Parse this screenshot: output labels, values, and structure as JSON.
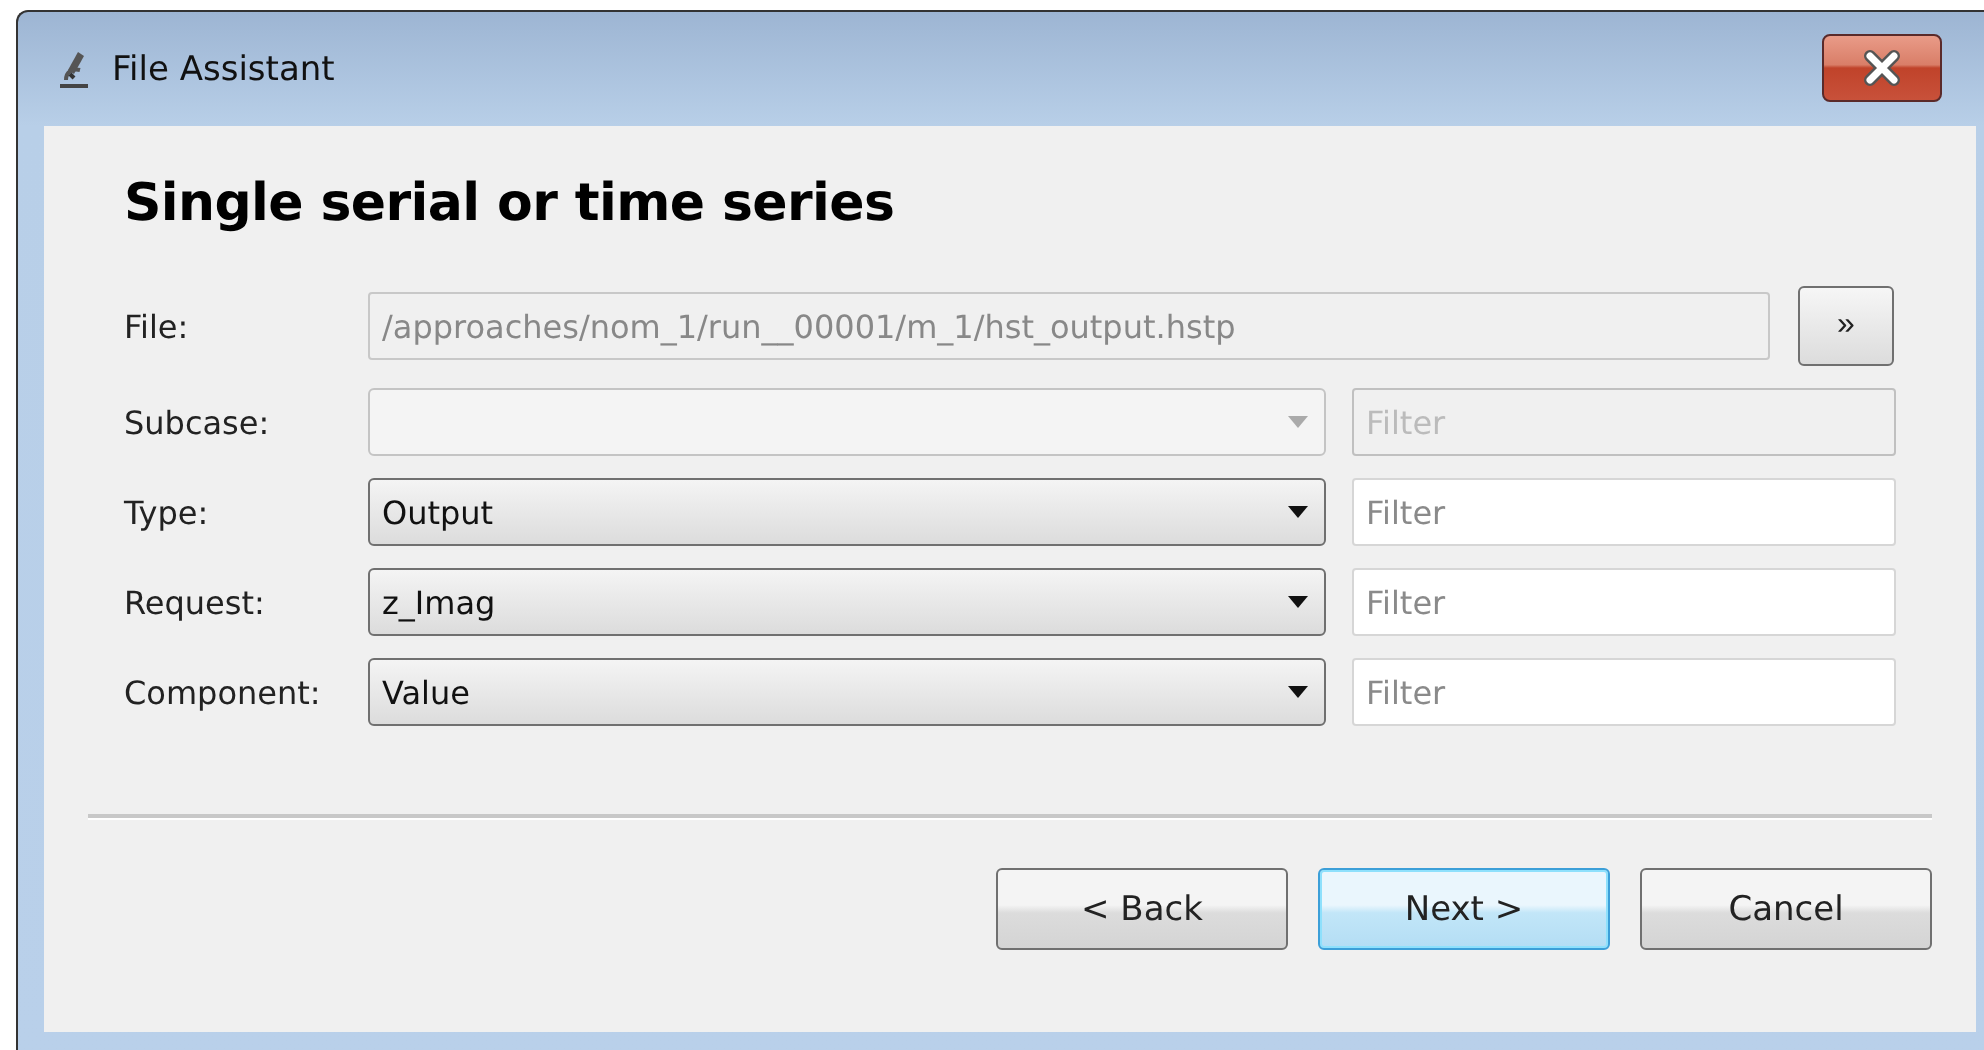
{
  "window": {
    "title": "File Assistant"
  },
  "heading": "Single serial or time series",
  "file": {
    "label": "File:",
    "value": "/approaches/nom_1/run__00001/m_1/hst_output.hstp",
    "disabled": true,
    "browse": "»"
  },
  "rows": [
    {
      "label": "Subcase:",
      "value": "",
      "disabled": true,
      "filter": {
        "placeholder": "Filter",
        "disabled": true
      }
    },
    {
      "label": "Type:",
      "value": "Output",
      "disabled": false,
      "filter": {
        "placeholder": "Filter",
        "disabled": false
      }
    },
    {
      "label": "Request:",
      "value": "z_Imag",
      "disabled": false,
      "filter": {
        "placeholder": "Filter",
        "disabled": false
      }
    },
    {
      "label": "Component:",
      "value": "Value",
      "disabled": false,
      "filter": {
        "placeholder": "Filter",
        "disabled": false
      }
    }
  ],
  "buttons": [
    {
      "label": "< Back",
      "default": false
    },
    {
      "label": "Next >",
      "default": true
    },
    {
      "label": "Cancel",
      "default": false
    }
  ]
}
